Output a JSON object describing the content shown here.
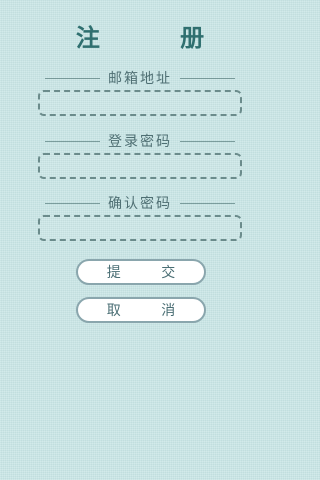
{
  "title": "注 册",
  "fields": {
    "email": {
      "label": "邮箱地址",
      "value": ""
    },
    "password": {
      "label": "登录密码",
      "value": ""
    },
    "confirm": {
      "label": "确认密码",
      "value": ""
    }
  },
  "buttons": {
    "submit": "提 交",
    "cancel": "取 消"
  }
}
